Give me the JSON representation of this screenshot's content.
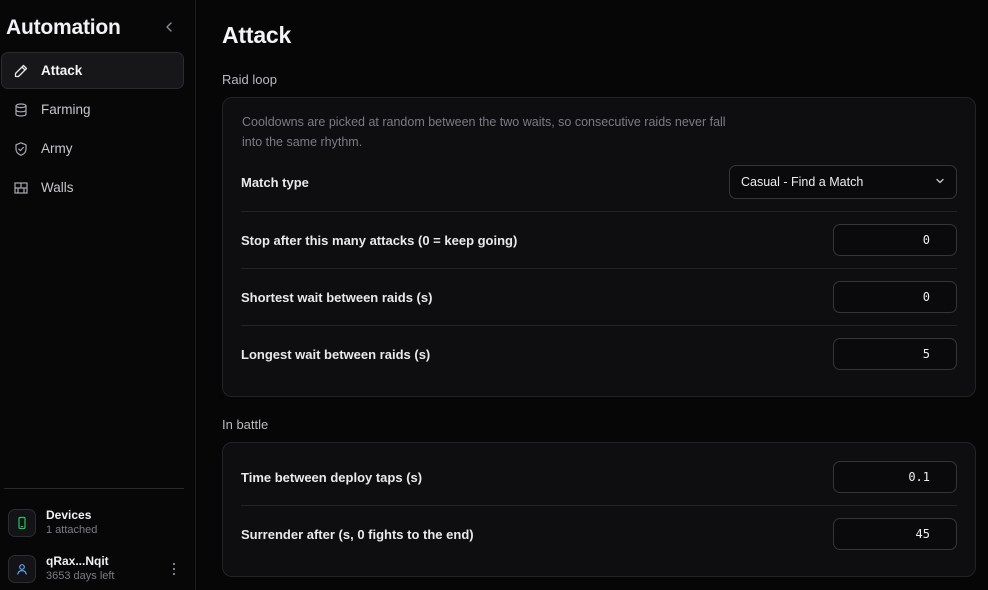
{
  "sidebar": {
    "title": "Automation",
    "items": [
      {
        "label": "Attack",
        "icon": "pencil-icon",
        "active": true
      },
      {
        "label": "Farming",
        "icon": "database-icon",
        "active": false
      },
      {
        "label": "Army",
        "icon": "shield-check-icon",
        "active": false
      },
      {
        "label": "Walls",
        "icon": "bricks-icon",
        "active": false
      }
    ],
    "devices": {
      "title": "Devices",
      "subtitle": "1 attached",
      "icon": "smartphone-icon"
    },
    "account": {
      "name": "qRax...Nqit",
      "subtitle": "3653 days left",
      "icon": "user-icon"
    }
  },
  "main": {
    "title": "Attack",
    "raid_loop": {
      "label": "Raid loop",
      "hint": "Cooldowns are picked at random between the two waits, so consecutive raids never fall into the same rhythm.",
      "match_type": {
        "label": "Match type",
        "value": "Casual - Find a Match"
      },
      "stop_after": {
        "label": "Stop after this many attacks (0 = keep going)",
        "value": "0"
      },
      "shortest_wait": {
        "label": "Shortest wait between raids (s)",
        "value": "0"
      },
      "longest_wait": {
        "label": "Longest wait between raids (s)",
        "value": "5"
      }
    },
    "in_battle": {
      "label": "In battle",
      "deploy_taps": {
        "label": "Time between deploy taps (s)",
        "value": "0.1"
      },
      "surrender_after": {
        "label": "Surrender after (s, 0 fights to the end)",
        "value": "45"
      }
    }
  },
  "colors": {
    "background": "#060607",
    "panel": "#0e0e10",
    "border": "#232327",
    "accent_device": "#22c55e",
    "accent_user": "#60a5fa"
  }
}
